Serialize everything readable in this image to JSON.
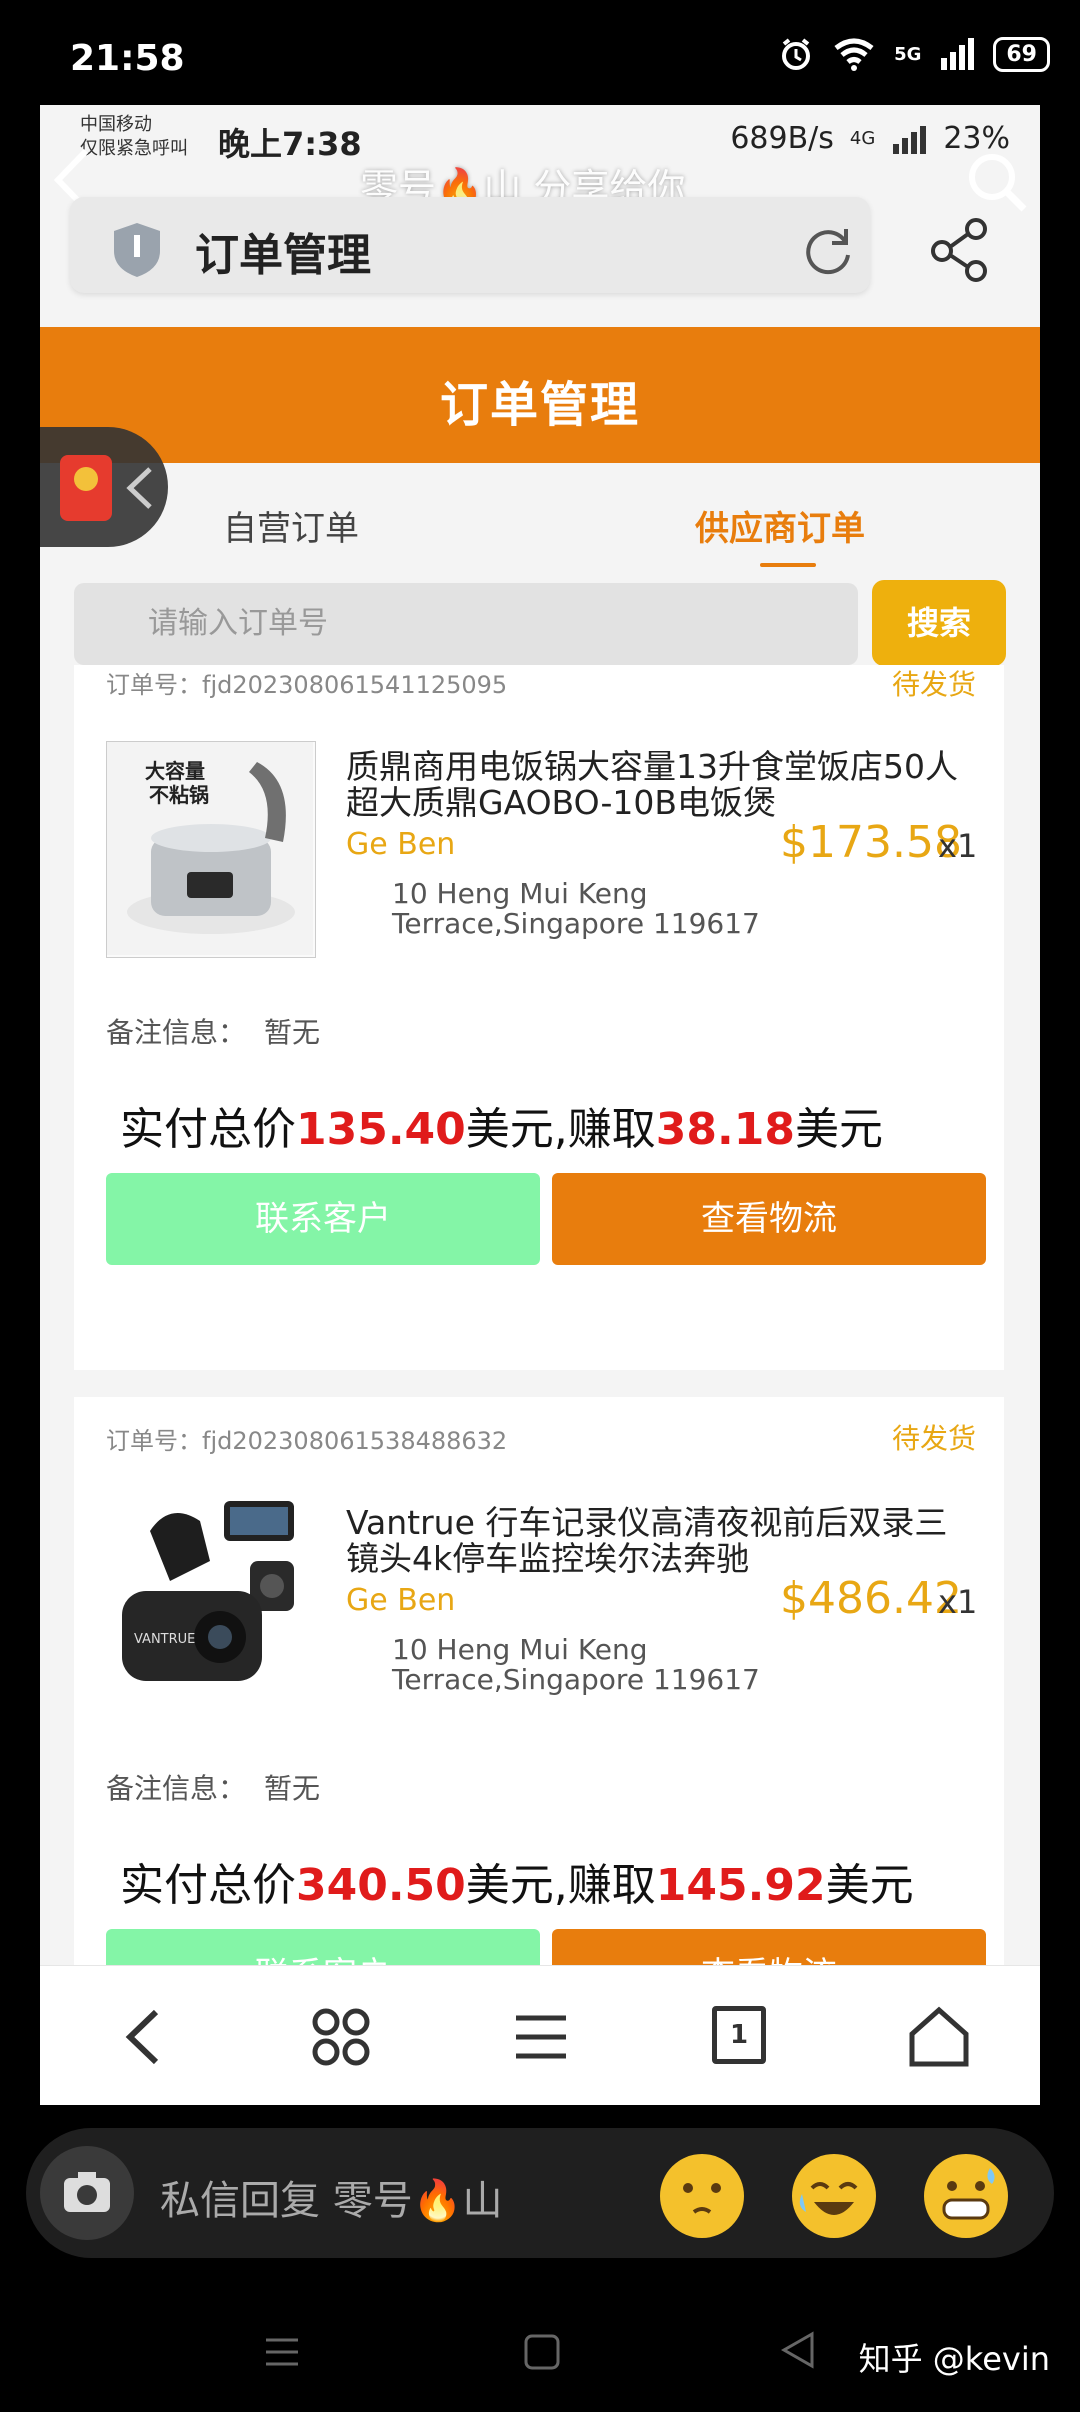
{
  "outer_status": {
    "time": "21:58",
    "network": "5G",
    "battery": "69"
  },
  "inner_status": {
    "carrier_line1": "中国移动",
    "carrier_line2": "仅限紧急呼叫",
    "time": "晚上7:38",
    "speed": "689B/s",
    "net": "4G",
    "battery": "23%"
  },
  "share_overlay": {
    "text": "零号🔥山 分享给你"
  },
  "browser": {
    "title": "订单管理"
  },
  "page": {
    "header_title": "订单管理"
  },
  "tabs": [
    {
      "label": "自营订单",
      "active": false
    },
    {
      "label": "供应商订单",
      "active": true
    }
  ],
  "search": {
    "placeholder": "请输入订单号",
    "button": "搜索"
  },
  "orders": [
    {
      "order_no": "订单号：fjd202308061541125095",
      "status": "待发货",
      "product_name": "质鼎商用电饭锅大容量13升食堂饭店50人超大质鼎GAOBO-10B电饭煲",
      "thumb_text_1": "大容量",
      "thumb_text_2": "不粘锅",
      "customer": "Ge Ben",
      "price": "$173.58",
      "qty": "x1",
      "address_line1": "10 Heng Mui Keng",
      "address_line2": "Terrace,Singapore 119617",
      "remark_label": "备注信息：",
      "remark_value": "暂无",
      "total_prefix": "实付总价",
      "total_amount": "135.40",
      "total_mid": "美元,赚取",
      "earn_amount": "38.18",
      "total_suffix": "美元",
      "contact_button": "联系客户",
      "logistics_button": "查看物流"
    },
    {
      "order_no": "订单号：fjd202308061538488632",
      "status": "待发货",
      "product_name": "Vantrue 行车记录仪高清夜视前后双录三镜头4k停车监控埃尔法奔驰",
      "thumb_text_1": "VANTRUE",
      "customer": "Ge Ben",
      "price": "$486.42",
      "qty": "x1",
      "address_line1": "10 Heng Mui Keng",
      "address_line2": "Terrace,Singapore 119617",
      "remark_label": "备注信息：",
      "remark_value": "暂无",
      "total_prefix": "实付总价",
      "total_amount": "340.50",
      "total_mid": "美元,赚取",
      "earn_amount": "145.92",
      "total_suffix": "美元",
      "contact_button": "联系客户",
      "logistics_button": "查看物流"
    }
  ],
  "bottom_nav": {
    "tab_count": "1"
  },
  "reply": {
    "placeholder": "私信回复 零号🔥山"
  },
  "watermark": {
    "text": "知乎 @kevin"
  },
  "colors": {
    "accent_orange": "#e87d0d",
    "status_yellow": "#e8a714",
    "search_yellow": "#eeb00d",
    "contact_green": "#84f5a7",
    "money_red": "#e01b1b"
  },
  "icons": [
    "back-icon",
    "search-icon",
    "shield-icon",
    "reload-icon",
    "share-icon",
    "red-packet-icon",
    "chevron-left-icon",
    "nav-back-icon",
    "apps-icon",
    "menu-icon",
    "tabs-icon",
    "home-icon",
    "camera-icon",
    "emoji-icon",
    "sys-menu-icon",
    "sys-home-icon",
    "sys-back-icon",
    "alarm-icon",
    "wifi-icon",
    "signal-icon",
    "battery-icon"
  ]
}
